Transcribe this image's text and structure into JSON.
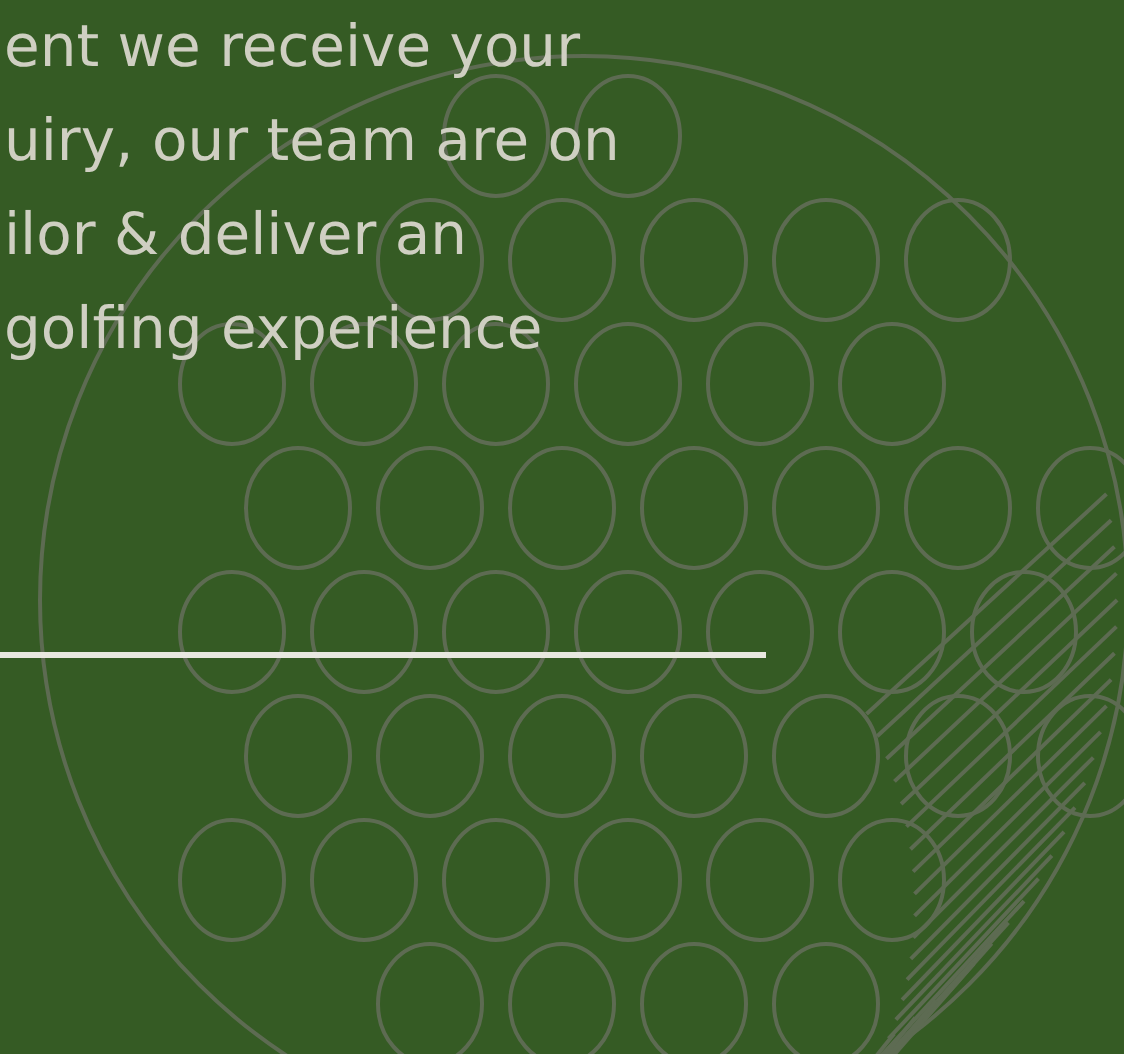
{
  "intro": {
    "lines": [
      "ent we receive your",
      "uiry, our team are on",
      "ilor & deliver an",
      "golfing experience"
    ]
  }
}
